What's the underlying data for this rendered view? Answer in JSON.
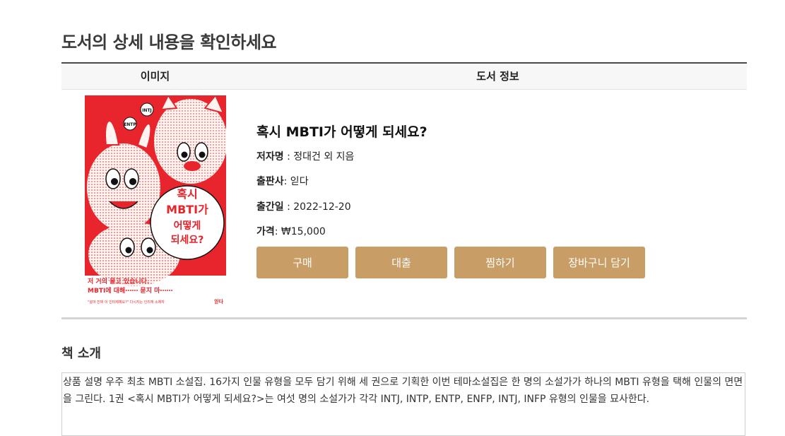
{
  "page": {
    "title": "도서의 상세 내용을 확인하세요"
  },
  "table": {
    "col_image": "이미지",
    "col_info": "도서 정보"
  },
  "book": {
    "title": "혹시 MBTI가 어떻게 되세요?",
    "author_label": "저자명",
    "author_value": " : 정대건 외 지음",
    "publisher_label": "출판사",
    "publisher_value": ": 읻다",
    "date_label": "출간일",
    "date_value": " : 2022-12-20",
    "price_label": "가격",
    "price_value": ": ₩15,000",
    "cover": {
      "badge_top": "INTJ",
      "badge_side": "ENTP",
      "title_line1": "혹시",
      "title_line2": "MBTI가",
      "title_line3": "어떻게",
      "title_line4": "되세요?",
      "tagline_line1": "저 거의 올고 있습니다.",
      "tagline_line2": "MBTI에 대해⋯⋯ 묻지 마⋯⋯",
      "quote": "\"설마 진짜 이 인터제예요?\" 다시지는 인리재 소제자",
      "publisher_mark": "읻다",
      "colors": {
        "red": "#e8242c",
        "cream": "#fff4ef"
      }
    }
  },
  "actions": {
    "buy": "구매",
    "rent": "대출",
    "wish": "찜하기",
    "cart": "장바구니 담기"
  },
  "intro": {
    "heading": "책 소개",
    "text": "상품 설명 우주 최초 MBTI 소설집. 16가지 인물 유형을 모두 담기 위해 세 권으로 기획한 이번 테마소설집은 한 명의 소설가가 하나의 MBTI 유형을 택해 인물의 면면을 그린다. 1권 <혹시 MBTI가 어떻게 되세요?>는 여섯 명의 소설가가 각각 INTJ, INTP, ENTP, ENFP, INTJ, INFP 유형의 인물을 묘사한다."
  }
}
